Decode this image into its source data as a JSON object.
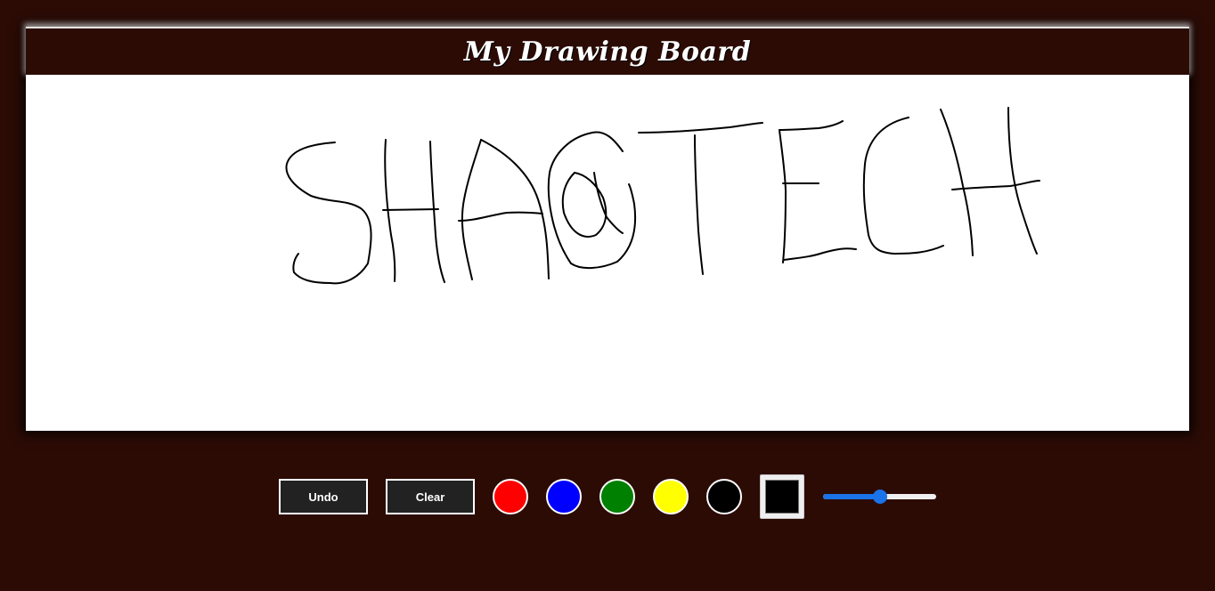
{
  "app": {
    "title": "My Drawing Board"
  },
  "toolbar": {
    "undo_label": "Undo",
    "clear_label": "Clear",
    "colors": [
      {
        "name": "red",
        "hex": "#ff0000"
      },
      {
        "name": "blue",
        "hex": "#0000ff"
      },
      {
        "name": "green",
        "hex": "#008000"
      },
      {
        "name": "yellow",
        "hex": "#ffff00"
      },
      {
        "name": "black",
        "hex": "#000000"
      }
    ],
    "picker_color": "#000000",
    "brush_size_fraction": 0.5
  },
  "theme": {
    "background": "#2c0b05",
    "button_bg": "#222222",
    "accent": "#1a73e8"
  }
}
